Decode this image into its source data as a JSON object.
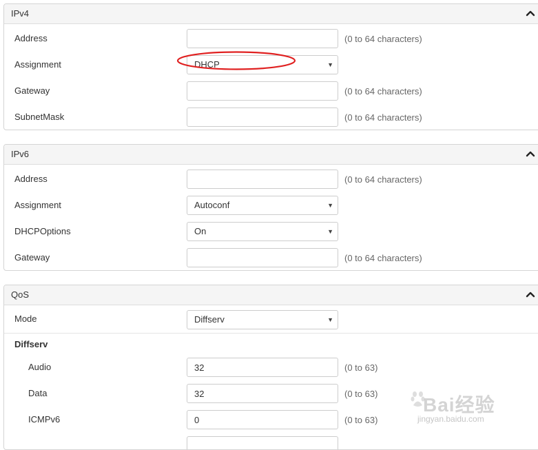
{
  "ipv4": {
    "title": "IPv4",
    "address": {
      "label": "Address",
      "value": "",
      "hint": "(0 to 64 characters)"
    },
    "assignment": {
      "label": "Assignment",
      "value": "DHCP"
    },
    "gateway": {
      "label": "Gateway",
      "value": "",
      "hint": "(0 to 64 characters)"
    },
    "subnetmask": {
      "label": "SubnetMask",
      "value": "",
      "hint": "(0 to 64 characters)"
    }
  },
  "ipv6": {
    "title": "IPv6",
    "address": {
      "label": "Address",
      "value": "",
      "hint": "(0 to 64 characters)"
    },
    "assignment": {
      "label": "Assignment",
      "value": "Autoconf"
    },
    "dhcpoptions": {
      "label": "DHCPOptions",
      "value": "On"
    },
    "gateway": {
      "label": "Gateway",
      "value": "",
      "hint": "(0 to 64 characters)"
    }
  },
  "qos": {
    "title": "QoS",
    "mode": {
      "label": "Mode",
      "value": "Diffserv"
    },
    "diffserv_heading": "Diffserv",
    "audio": {
      "label": "Audio",
      "value": "32",
      "hint": "(0 to 63)"
    },
    "data": {
      "label": "Data",
      "value": "32",
      "hint": "(0 to 63)"
    },
    "icmpv6": {
      "label": "ICMPv6",
      "value": "0",
      "hint": "(0 to 63)"
    }
  },
  "watermark": {
    "brand": "Bai经验",
    "url": "jingyan.baidu.com"
  },
  "icons": {
    "collapse": "chevron-up-icon",
    "dropdown": "caret-down-icon"
  },
  "colors": {
    "annotation": "#e02020",
    "header_bg": "#f5f5f5",
    "border": "#d4d4d4"
  }
}
